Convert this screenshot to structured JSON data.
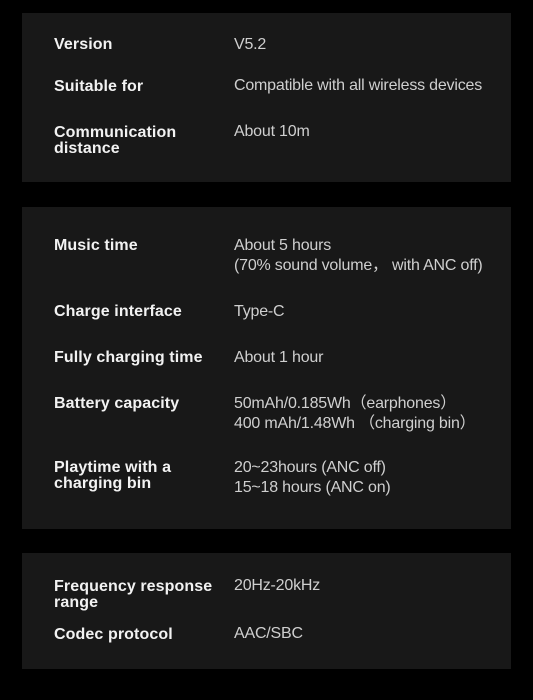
{
  "sections": [
    {
      "rows": [
        {
          "label": "Version",
          "value": "V5.2"
        },
        {
          "label": "Suitable for",
          "value": "Compatible with all wireless devices"
        },
        {
          "label": "Communication\ndistance",
          "value": "About 10m"
        }
      ]
    },
    {
      "rows": [
        {
          "label": "Music time",
          "value": "About 5 hours\n(70% sound volume，  with ANC off)"
        },
        {
          "label": "Charge interface",
          "value": "Type-C"
        },
        {
          "label": "Fully charging time",
          "value": "About 1 hour"
        },
        {
          "label": "Battery capacity",
          "value": "50mAh/0.185Wh（earphones）\n400 mAh/1.48Wh （charging bin）"
        },
        {
          "label": "Playtime with a\ncharging bin",
          "value": "20~23hours (ANC off)\n15~18 hours (ANC on)"
        }
      ]
    },
    {
      "rows": [
        {
          "label": "Frequency response\nrange",
          "value": "20Hz-20kHz"
        },
        {
          "label": "Codec protocol",
          "value": "AAC/SBC"
        }
      ]
    }
  ],
  "colors": {
    "background": "#000000",
    "panel": "#181818",
    "label": "#f2f2f2",
    "value": "#cfcfcf"
  }
}
